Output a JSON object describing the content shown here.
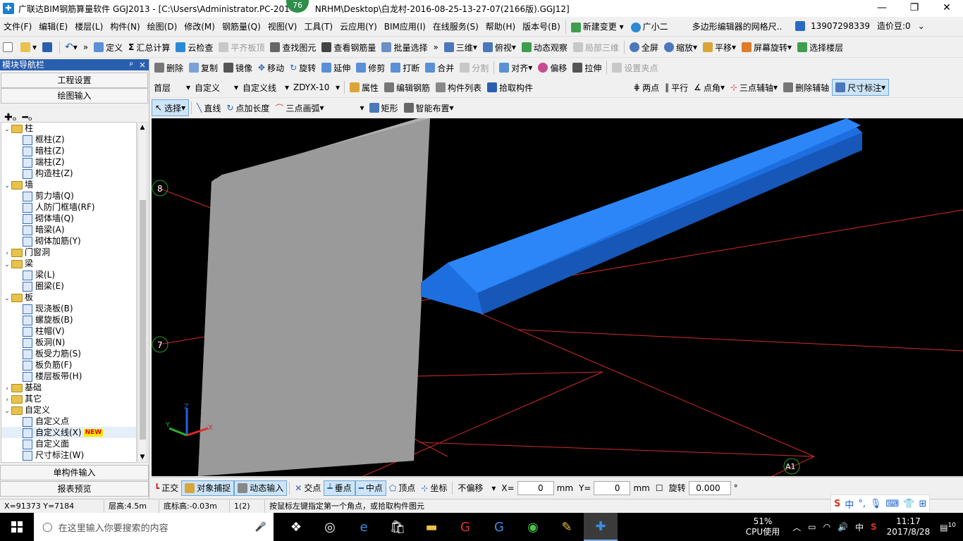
{
  "window": {
    "title": "广联达BIM钢筋算量软件 GGJ2013 - [C:\\Users\\Administrator.PC-201",
    "title_tail": "NRHM\\Desktop\\白龙村-2016-08-25-13-27-07(2166版).GGJ12]",
    "badge": "76",
    "minimize": "—",
    "restore": "❐",
    "close": "✕"
  },
  "menu": {
    "items": [
      "文件(F)",
      "编辑(E)",
      "楼层(L)",
      "构件(N)",
      "绘图(D)",
      "修改(M)",
      "钢筋量(Q)",
      "视图(V)",
      "工具(T)",
      "云应用(Y)",
      "BIM应用(I)",
      "在线服务(S)",
      "帮助(H)",
      "版本号(B)"
    ],
    "new_change": "新建变更",
    "assistant": "广小二",
    "tip": "多边形编辑器的网格尺..",
    "phone": "13907298339",
    "price_bean": "造价豆:0"
  },
  "toolbar1": {
    "define": "定义",
    "sum_calc": "汇总计算",
    "cloud_check": "云检查",
    "align_top": "平齐板顶",
    "find_elem": "查找图元",
    "view_rebar": "查看钢筋量",
    "batch_select": "批量选择",
    "view3d": "三维",
    "top_view": "俯视",
    "dynamic_view": "动态观察",
    "local_3d": "局部三维",
    "full_screen": "全屏",
    "zoom": "缩放",
    "pan": "平移",
    "rotate_screen": "屏幕旋转",
    "select_floor": "选择楼层"
  },
  "toolbar2": {
    "delete": "删除",
    "copy": "复制",
    "mirror": "镜像",
    "move": "移动",
    "rotate": "旋转",
    "extend": "延伸",
    "trim": "修剪",
    "break": "打断",
    "merge": "合并",
    "split": "分割",
    "align": "对齐",
    "offset": "偏移",
    "stretch": "拉伸",
    "set_grip": "设置夹点"
  },
  "toolbar3": {
    "floor": "首层",
    "category": "自定义",
    "type": "自定义线",
    "element": "ZDYX-10",
    "property": "属性",
    "edit_rebar": "编辑钢筋",
    "elem_list": "构件列表",
    "pick_elem": "拾取构件",
    "two_points": "两点",
    "parallel": "平行",
    "point_angle": "点角",
    "three_point_aux": "三点辅轴",
    "delete_aux": "删除辅轴",
    "dimension": "尺寸标注"
  },
  "toolbar4": {
    "select": "选择",
    "line": "直线",
    "point_length": "点加长度",
    "three_arc": "三点画弧",
    "rect": "矩形",
    "smart_layout": "智能布置"
  },
  "sidebar": {
    "header": "模块导航栏",
    "pin": "ᵖ",
    "close": "×",
    "project_settings": "工程设置",
    "drawing_input": "绘图输入",
    "single_input": "单构件输入",
    "report_preview": "报表预览",
    "tree": [
      {
        "level": 0,
        "toggle": "⌄",
        "label": "柱",
        "folder": true
      },
      {
        "level": 1,
        "label": "框柱(Z)"
      },
      {
        "level": 1,
        "label": "暗柱(Z)"
      },
      {
        "level": 1,
        "label": "端柱(Z)"
      },
      {
        "level": 1,
        "label": "构造柱(Z)"
      },
      {
        "level": 0,
        "toggle": "⌄",
        "label": "墙",
        "folder": true
      },
      {
        "level": 1,
        "label": "剪力墙(Q)"
      },
      {
        "level": 1,
        "label": "人防门框墙(RF)"
      },
      {
        "level": 1,
        "label": "砌体墙(Q)"
      },
      {
        "level": 1,
        "label": "暗梁(A)"
      },
      {
        "level": 1,
        "label": "砌体加筋(Y)"
      },
      {
        "level": 0,
        "toggle": "›",
        "label": "门窗洞",
        "folder": true
      },
      {
        "level": 0,
        "toggle": "⌄",
        "label": "梁",
        "folder": true
      },
      {
        "level": 1,
        "label": "梁(L)"
      },
      {
        "level": 1,
        "label": "圈梁(E)"
      },
      {
        "level": 0,
        "toggle": "⌄",
        "label": "板",
        "folder": true
      },
      {
        "level": 1,
        "label": "现浇板(B)"
      },
      {
        "level": 1,
        "label": "螺旋板(B)"
      },
      {
        "level": 1,
        "label": "柱帽(V)"
      },
      {
        "level": 1,
        "label": "板洞(N)"
      },
      {
        "level": 1,
        "label": "板受力筋(S)"
      },
      {
        "level": 1,
        "label": "板负筋(F)"
      },
      {
        "level": 1,
        "label": "楼层板带(H)"
      },
      {
        "level": 0,
        "toggle": "›",
        "label": "基础",
        "folder": true
      },
      {
        "level": 0,
        "toggle": "›",
        "label": "其它",
        "folder": true
      },
      {
        "level": 0,
        "toggle": "⌄",
        "label": "自定义",
        "folder": true
      },
      {
        "level": 1,
        "label": "自定义点"
      },
      {
        "level": 1,
        "label": "自定义线(X)",
        "new": "NEW",
        "selected": true
      },
      {
        "level": 1,
        "label": "自定义面"
      },
      {
        "level": 1,
        "label": "尺寸标注(W)"
      }
    ]
  },
  "canvas": {
    "axis_labels": [
      "8",
      "7",
      "A1"
    ],
    "axes": {
      "x": "X",
      "y": "Y",
      "z": "Z"
    }
  },
  "snapbar": {
    "ortho": "正交",
    "obj_snap": "对象捕捉",
    "dyn_input": "动态输入",
    "intersection": "交点",
    "perpendicular": "垂点",
    "midpoint": "中点",
    "vertex": "顶点",
    "coordinate": "坐标",
    "offset_mode": "不偏移",
    "x_label": "X=",
    "x_value": "0",
    "y_label": "Y=",
    "y_value": "0",
    "unit": "mm",
    "rotate_label": "旋转",
    "rotate_value": "0.000",
    "degree": "°"
  },
  "statusbar": {
    "coords": "X=91373 Y=7184",
    "floor_height": "层高:4.5m",
    "base_height": "底标高:-0.03m",
    "count": "1(2)",
    "hint": "按鼠标左键指定第一个角点，或拾取构件图元"
  },
  "ime": {
    "lang": "中"
  },
  "taskbar": {
    "search_placeholder": "在这里输入你要搜索的内容",
    "cpu_pct": "51%",
    "cpu_label": "CPU使用",
    "ime_lang": "中",
    "time": "11:17",
    "date": "2017/8/28",
    "notif": "10"
  }
}
